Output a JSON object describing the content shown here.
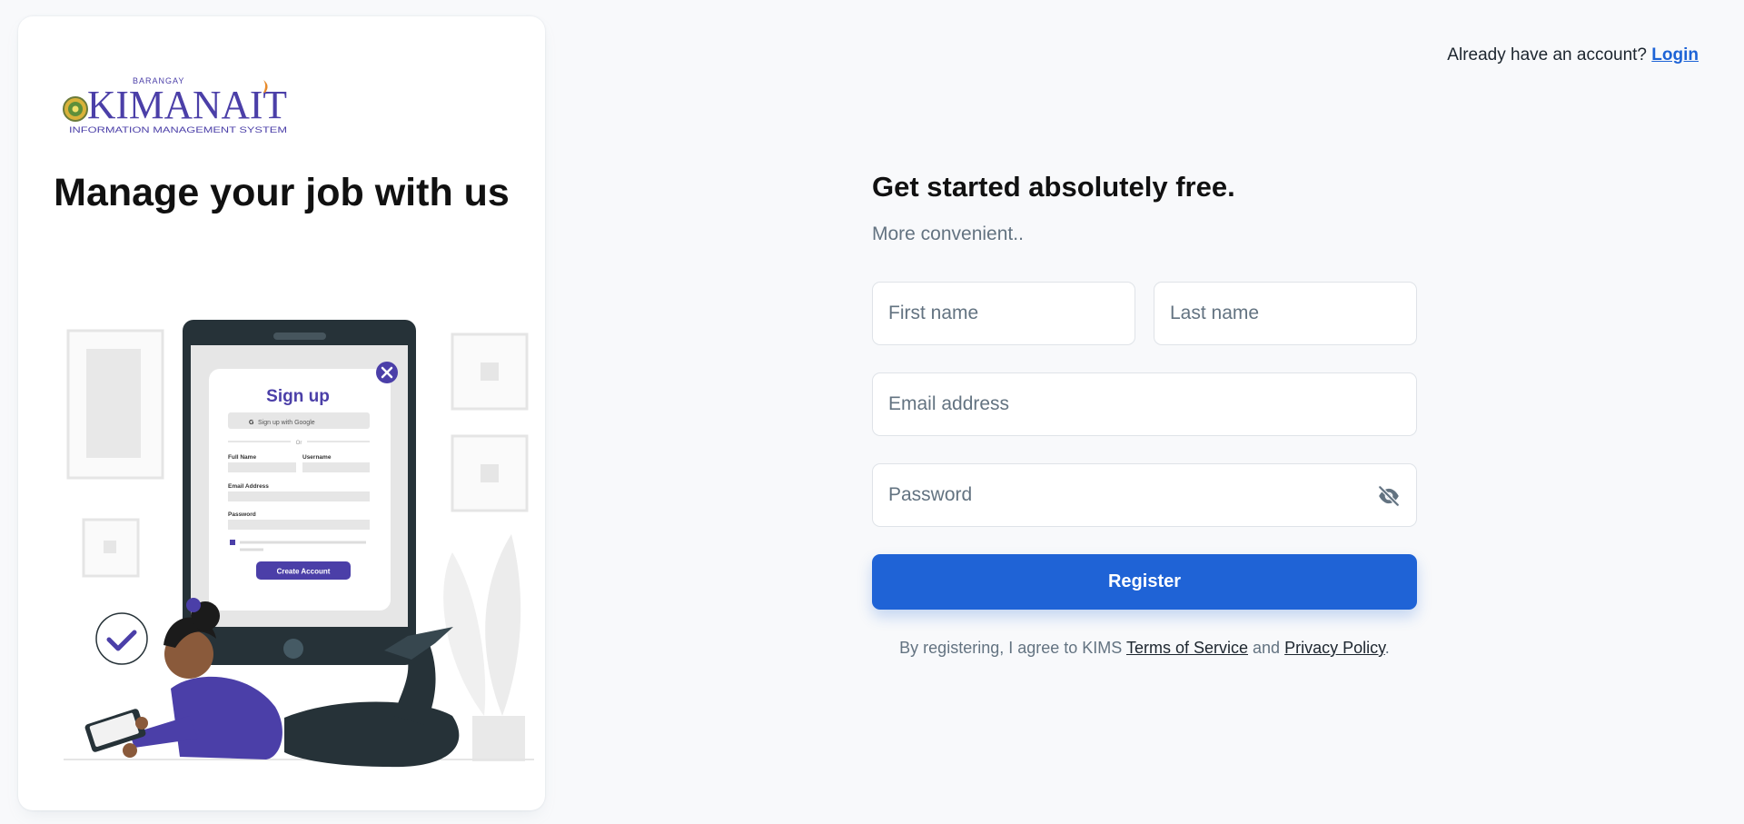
{
  "brand": {
    "logo_small_text": "BARANGAY",
    "logo_main_text": "KIMANAIT",
    "logo_sub_text": "INFORMATION MANAGEMENT SYSTEM"
  },
  "hero": {
    "title": "Manage your job with us"
  },
  "illustration": {
    "card_title": "Sign up",
    "google_button": "Sign up with Google",
    "or_text": "Or",
    "full_name_label": "Full Name",
    "username_label": "Username",
    "email_label": "Email Address",
    "password_label": "Password",
    "create_button": "Create Account"
  },
  "header": {
    "prompt": "Already have an account?",
    "login_link": "Login"
  },
  "form": {
    "title": "Get started absolutely free.",
    "subtitle": "More convenient..",
    "first_name": {
      "placeholder": "First name",
      "value": ""
    },
    "last_name": {
      "placeholder": "Last name",
      "value": ""
    },
    "email": {
      "placeholder": "Email address",
      "value": ""
    },
    "password": {
      "placeholder": "Password",
      "value": ""
    },
    "register_label": "Register",
    "terms_prefix": "By registering, I agree to KIMS",
    "terms_link": "Terms of Service",
    "terms_and": "and",
    "privacy_link": "Privacy Policy",
    "terms_suffix": "."
  },
  "colors": {
    "primary": "#1f63d6",
    "brand_purple": "#4b3fa8",
    "page_bg": "#f8f9fb",
    "muted_text": "#637381"
  },
  "icons": {
    "password_toggle": "eye-off-icon",
    "illustration_close": "close-icon",
    "illustration_check": "check-icon",
    "google": "google-icon"
  }
}
